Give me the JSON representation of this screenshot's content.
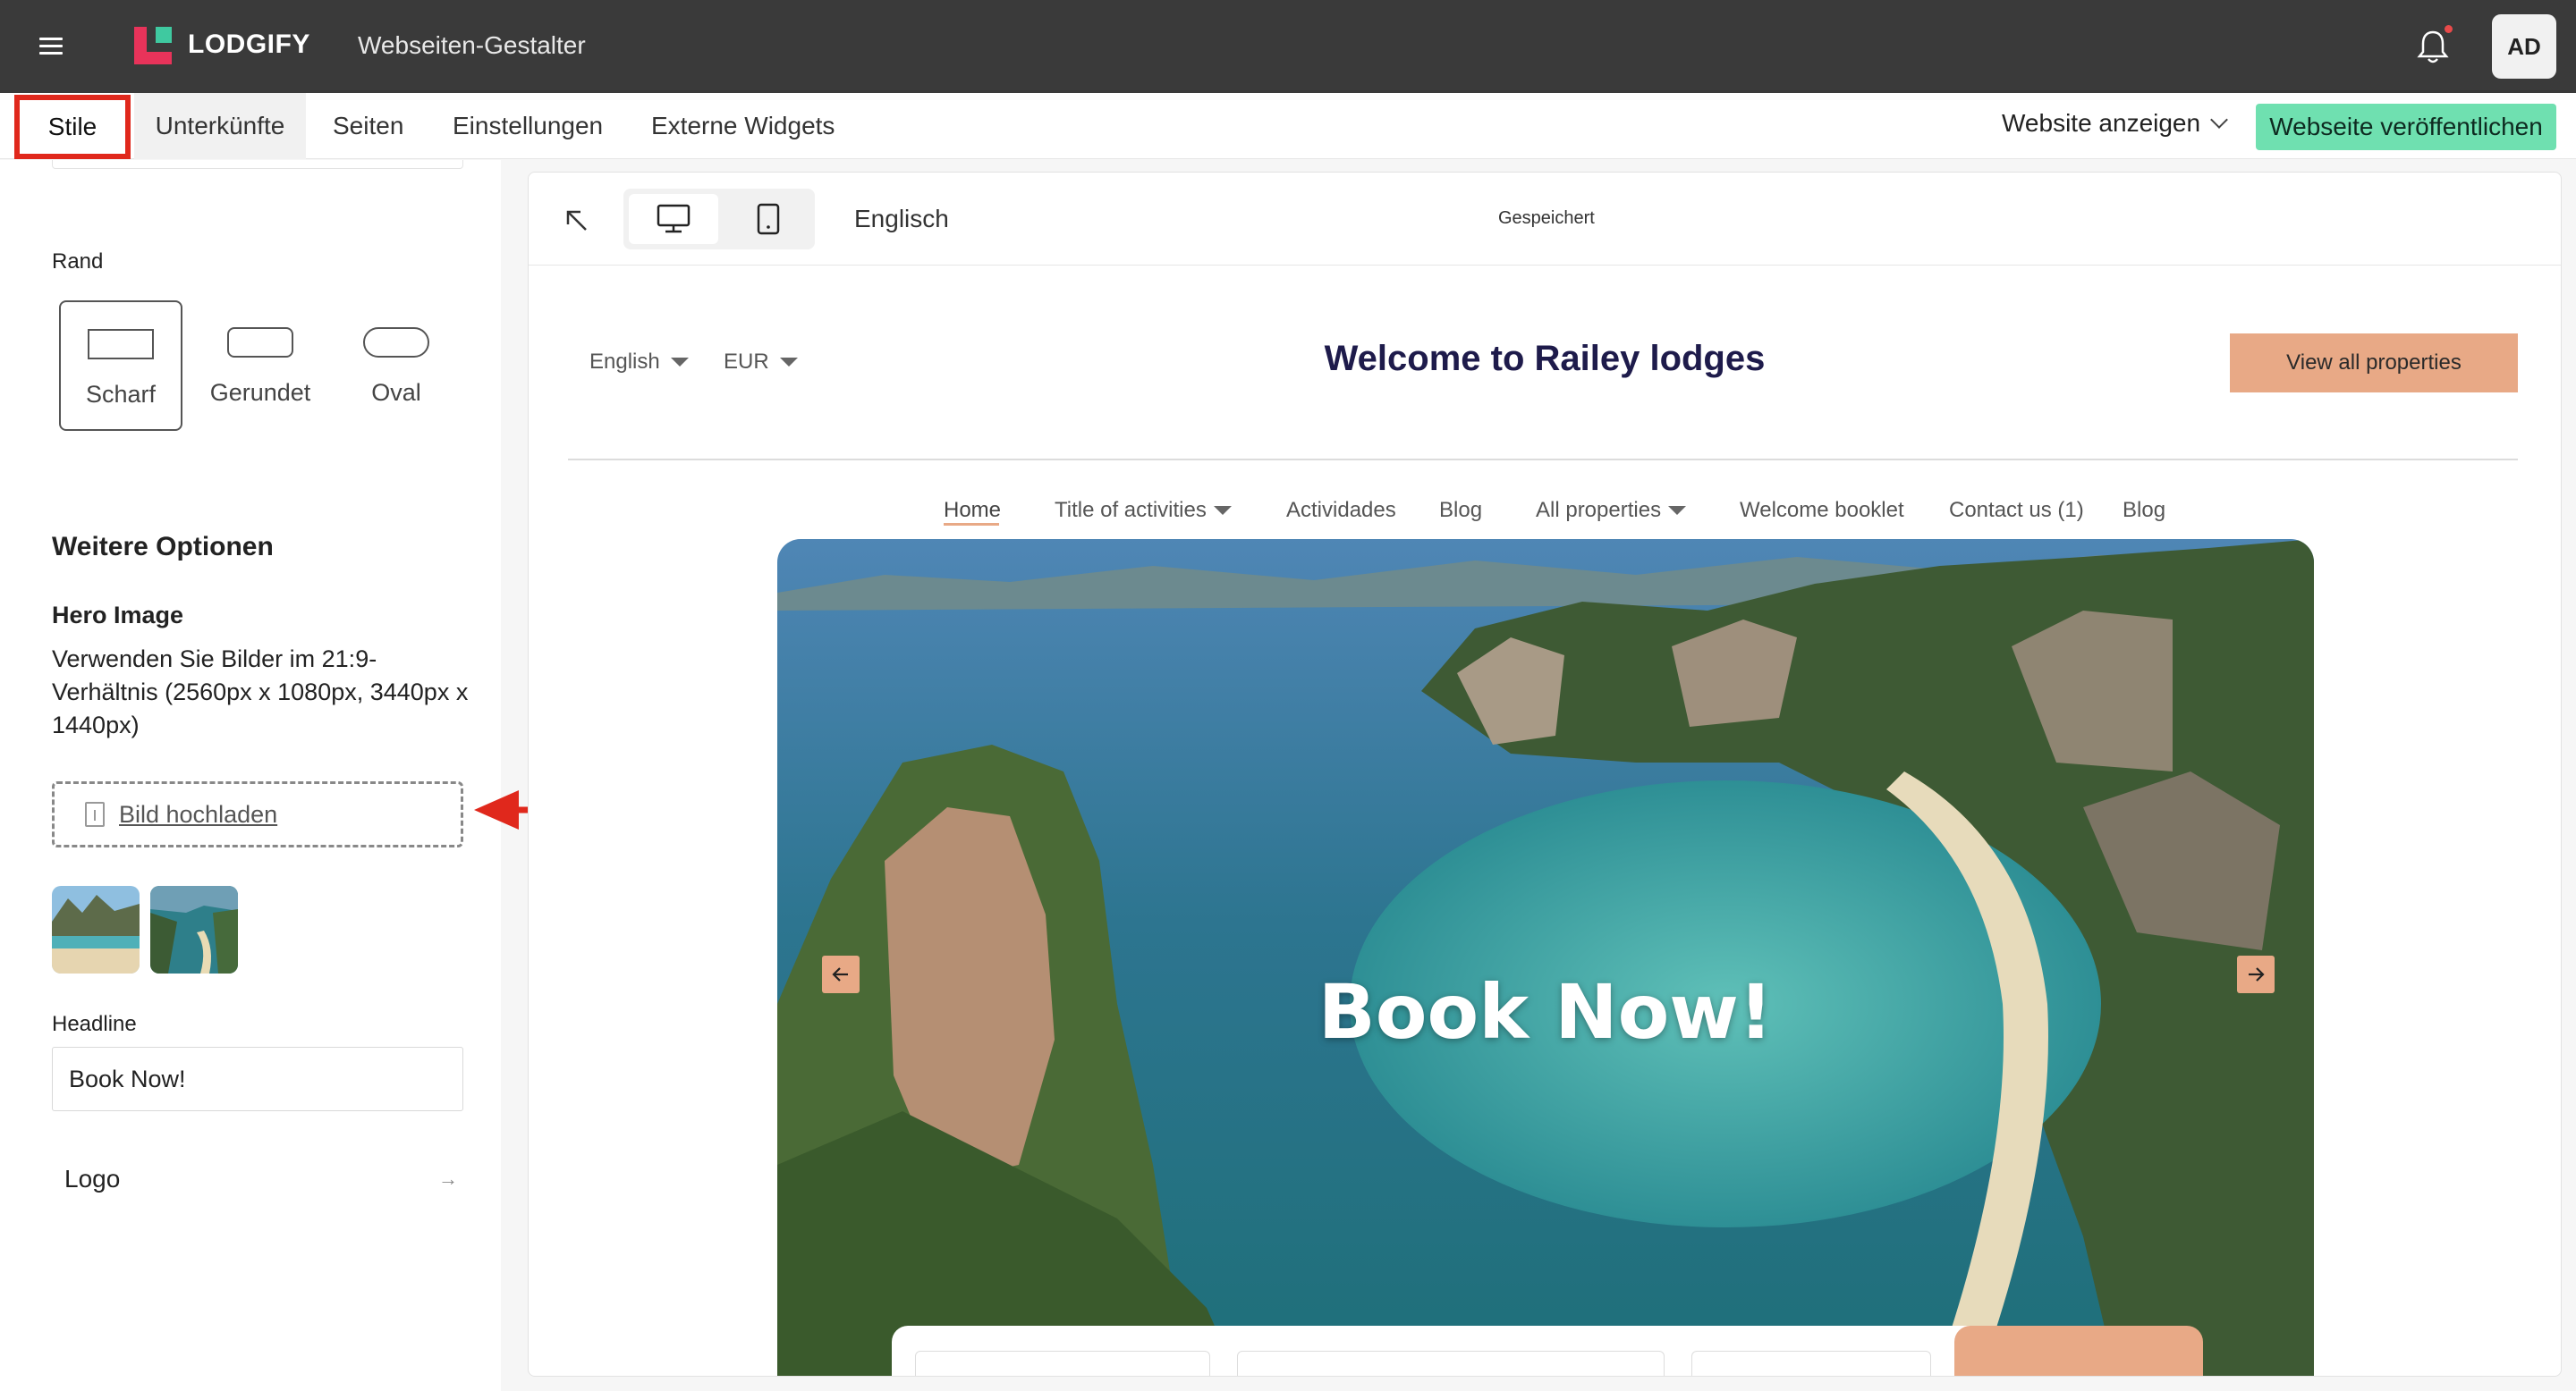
{
  "app": {
    "brand": "LODGIFY",
    "title": "Webseiten-Gestalter",
    "avatar_initials": "AD",
    "brand_color": "#e8335a",
    "accent_color": "#6fe0b0"
  },
  "tabs": [
    {
      "label": "Stile",
      "highlighted": true
    },
    {
      "label": "Unterkünfte"
    },
    {
      "label": "Seiten"
    },
    {
      "label": "Einstellungen"
    },
    {
      "label": "Externe Widgets"
    }
  ],
  "header_actions": {
    "view_site": "Website anzeigen",
    "publish": "Webseite veröffentlichen"
  },
  "sidebar": {
    "border_label": "Rand",
    "border_options": [
      {
        "label": "Scharf",
        "selected": true
      },
      {
        "label": "Gerundet"
      },
      {
        "label": "Oval"
      }
    ],
    "more_options_title": "Weitere Optionen",
    "hero_title": "Hero Image",
    "hero_desc": "Verwenden Sie Bilder im 21:9-Verhältnis (2560px x 1080px, 3440px x 1440px)",
    "upload_label": "Bild hochladen",
    "headline_label": "Headline",
    "headline_value": "Book Now!",
    "logo_label": "Logo"
  },
  "canvas": {
    "language": "Englisch",
    "status": "Gespeichert",
    "site": {
      "lang": "English",
      "currency": "EUR",
      "title": "Welcome to Railey lodges",
      "cta": "View all properties",
      "nav": [
        "Home",
        "Title of activities",
        "Actividades",
        "Blog",
        "All properties",
        "Welcome booklet",
        "Contact us (1)",
        "Blog"
      ],
      "hero_headline": "Book Now!"
    }
  }
}
